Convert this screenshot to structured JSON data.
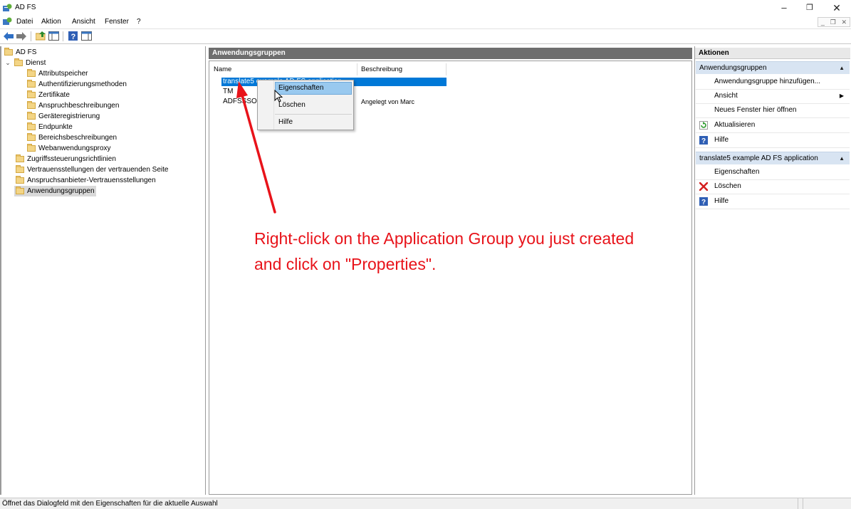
{
  "window": {
    "title": "AD FS"
  },
  "menu": {
    "items": [
      "Datei",
      "Aktion",
      "Ansicht",
      "Fenster",
      "?"
    ]
  },
  "tree": {
    "root": "AD FS",
    "service": "Dienst",
    "service_children": [
      "Attributspeicher",
      "Authentifizierungsmethoden",
      "Zertifikate",
      "Anspruchbeschreibungen",
      "Geräteregistrierung",
      "Endpunkte",
      "Bereichsbeschreibungen",
      "Webanwendungsproxy"
    ],
    "top_items": [
      "Zugriffssteuerungsrichtlinien",
      "Vertrauensstellungen der vertrauenden Seite",
      "Anspruchsanbieter-Vertrauensstellungen",
      "Anwendungsgruppen"
    ]
  },
  "main": {
    "header": "Anwendungsgruppen",
    "columns": {
      "name": "Name",
      "description": "Beschreibung"
    },
    "rows": [
      {
        "name": "translate5 example AD FS application",
        "description": ""
      },
      {
        "name": "TM",
        "description": ""
      },
      {
        "name": "ADFSSSO",
        "description": "Angelegt von Marc"
      }
    ]
  },
  "context_menu": {
    "properties": "Eigenschaften",
    "delete": "Löschen",
    "help": "Hilfe"
  },
  "annotation": {
    "line1": "Right-click on the Application Group you just created",
    "line2": "and click on \"Properties\".",
    "color": "#e8131a"
  },
  "actions": {
    "title": "Aktionen",
    "section1": {
      "title": "Anwendungsgruppen",
      "items": [
        {
          "label": "Anwendungsgruppe hinzufügen...",
          "icon": "none"
        },
        {
          "label": "Ansicht",
          "icon": "none"
        },
        {
          "label": "Neues Fenster hier öffnen",
          "icon": "none"
        },
        {
          "label": "Aktualisieren",
          "icon": "refresh-icon"
        },
        {
          "label": "Hilfe",
          "icon": "help-icon"
        }
      ]
    },
    "section2": {
      "title": "translate5 example AD FS application",
      "items": [
        {
          "label": "Eigenschaften",
          "icon": "none"
        },
        {
          "label": "Löschen",
          "icon": "delete-icon"
        },
        {
          "label": "Hilfe",
          "icon": "help-icon"
        }
      ]
    }
  },
  "status": {
    "text": "Öffnet das Dialogfeld mit den Eigenschaften für die aktuelle Auswahl"
  },
  "colors": {
    "selection": "#0078d7",
    "menu_highlight": "#99c9ef",
    "section_bg": "#d8e4f2",
    "pane_header": "#6e6e6e"
  }
}
